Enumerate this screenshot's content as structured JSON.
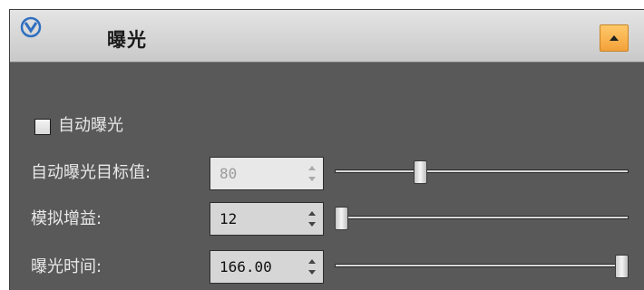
{
  "header": {
    "title": "曝光",
    "logo_icon": "v-logo-icon",
    "collapse_icon": "chevron-up-icon",
    "collapse_color": "#f3a23a"
  },
  "auto_exposure": {
    "label": "自动曝光",
    "checked": false
  },
  "rows": [
    {
      "label": "自动曝光目标值:",
      "value": "80",
      "enabled": false,
      "slider_fraction": 0.28
    },
    {
      "label": "模拟增益:",
      "value": "12",
      "enabled": true,
      "slider_fraction": 0.0
    },
    {
      "label": "曝光时间:",
      "value": "166.00",
      "enabled": true,
      "slider_fraction": 1.0
    }
  ]
}
